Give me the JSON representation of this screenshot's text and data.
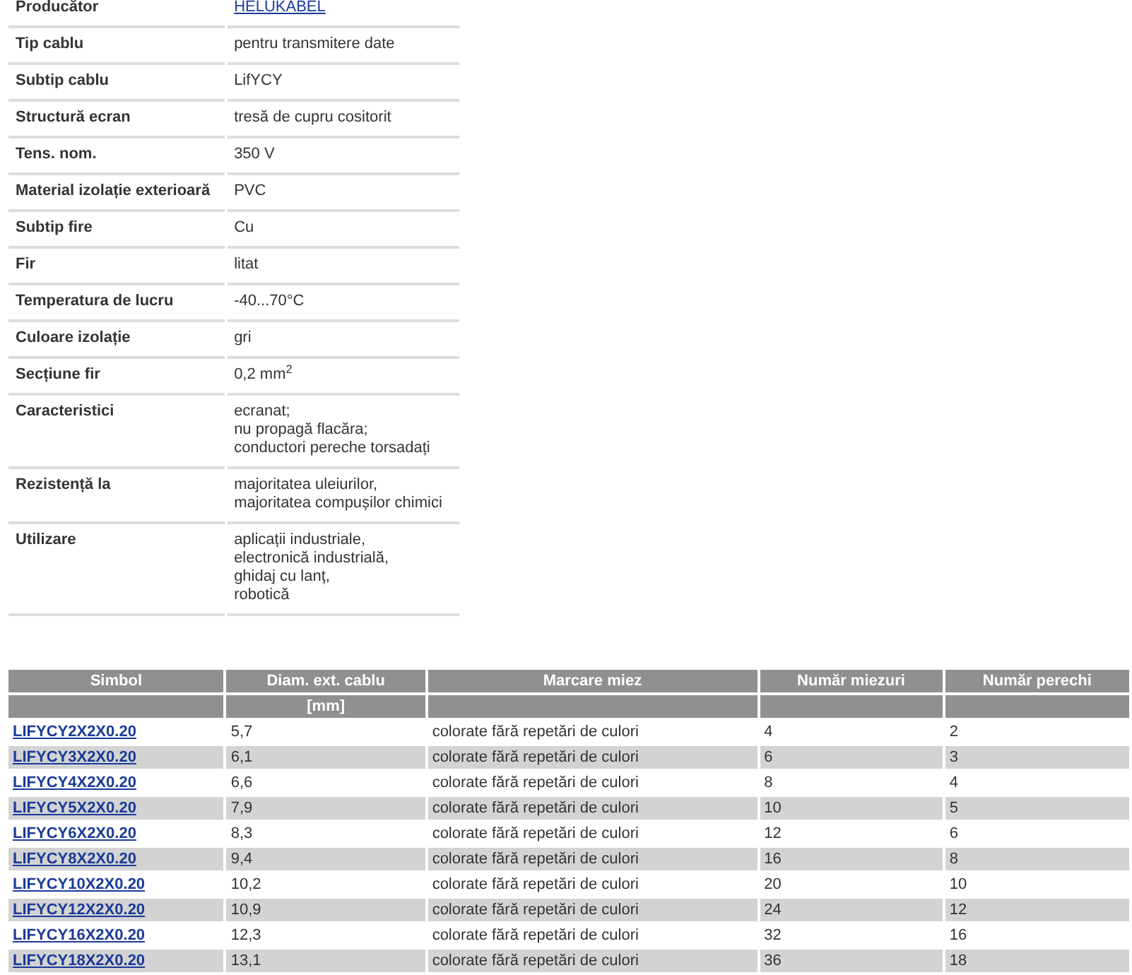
{
  "specs": [
    {
      "label": "Producător",
      "kind": "link",
      "lines": [
        "HELUKABEL"
      ]
    },
    {
      "label": "Tip cablu",
      "kind": "text",
      "lines": [
        "pentru transmitere date"
      ]
    },
    {
      "label": "Subtip cablu",
      "kind": "text",
      "lines": [
        "LifYCY"
      ]
    },
    {
      "label": "Structură ecran",
      "kind": "text",
      "lines": [
        "tresă de cupru cositorit"
      ]
    },
    {
      "label": "Tens. nom.",
      "kind": "text",
      "lines": [
        "350 V"
      ]
    },
    {
      "label": "Material izolație exterioară",
      "kind": "text",
      "lines": [
        "PVC"
      ]
    },
    {
      "label": "Subtip fire",
      "kind": "text",
      "lines": [
        "Cu"
      ]
    },
    {
      "label": "Fir",
      "kind": "text",
      "lines": [
        "litat"
      ]
    },
    {
      "label": "Temperatura de lucru",
      "kind": "text",
      "lines": [
        "-40...70°C"
      ]
    },
    {
      "label": "Culoare izolație",
      "kind": "text",
      "lines": [
        "gri"
      ]
    },
    {
      "label": "Secțiune fir",
      "kind": "text",
      "lines": [
        "0,2 mm$^{2}$"
      ]
    },
    {
      "label": "Caracteristici",
      "kind": "text",
      "lines": [
        "ecranat;",
        "nu propagă flacăra;",
        "conductori pereche torsadați"
      ]
    },
    {
      "label": "Rezistență la",
      "kind": "text",
      "lines": [
        "majoritatea uleiurilor,",
        "majoritatea compușilor chimici"
      ]
    },
    {
      "label": "Utilizare",
      "kind": "text",
      "lines": [
        "aplicații industriale,",
        "electronică industrială,",
        "ghidaj cu lanț,",
        "robotică"
      ]
    }
  ],
  "table": {
    "columns": [
      {
        "label": "Simbol"
      },
      {
        "label": "Diam. ext. cablu",
        "unit": "[mm]"
      },
      {
        "label": "Marcare miez"
      },
      {
        "label": "Număr miezuri"
      },
      {
        "label": "Număr perechi"
      }
    ],
    "rows": [
      [
        "LIFYCY2X2X0.20",
        "5,7",
        "colorate fără repetări de culori",
        "4",
        "2"
      ],
      [
        "LIFYCY3X2X0.20",
        "6,1",
        "colorate fără repetări de culori",
        "6",
        "3"
      ],
      [
        "LIFYCY4X2X0.20",
        "6,6",
        "colorate fără repetări de culori",
        "8",
        "4"
      ],
      [
        "LIFYCY5X2X0.20",
        "7,9",
        "colorate fără repetări de culori",
        "10",
        "5"
      ],
      [
        "LIFYCY6X2X0.20",
        "8,3",
        "colorate fără repetări de culori",
        "12",
        "6"
      ],
      [
        "LIFYCY8X2X0.20",
        "9,4",
        "colorate fără repetări de culori",
        "16",
        "8"
      ],
      [
        "LIFYCY10X2X0.20",
        "10,2",
        "colorate fără repetări de culori",
        "20",
        "10"
      ],
      [
        "LIFYCY12X2X0.20",
        "10,9",
        "colorate fără repetări de culori",
        "24",
        "12"
      ],
      [
        "LIFYCY16X2X0.20",
        "12,3",
        "colorate fără repetări de culori",
        "32",
        "16"
      ],
      [
        "LIFYCY18X2X0.20",
        "13,1",
        "colorate fără repetări de culori",
        "36",
        "18"
      ]
    ]
  }
}
